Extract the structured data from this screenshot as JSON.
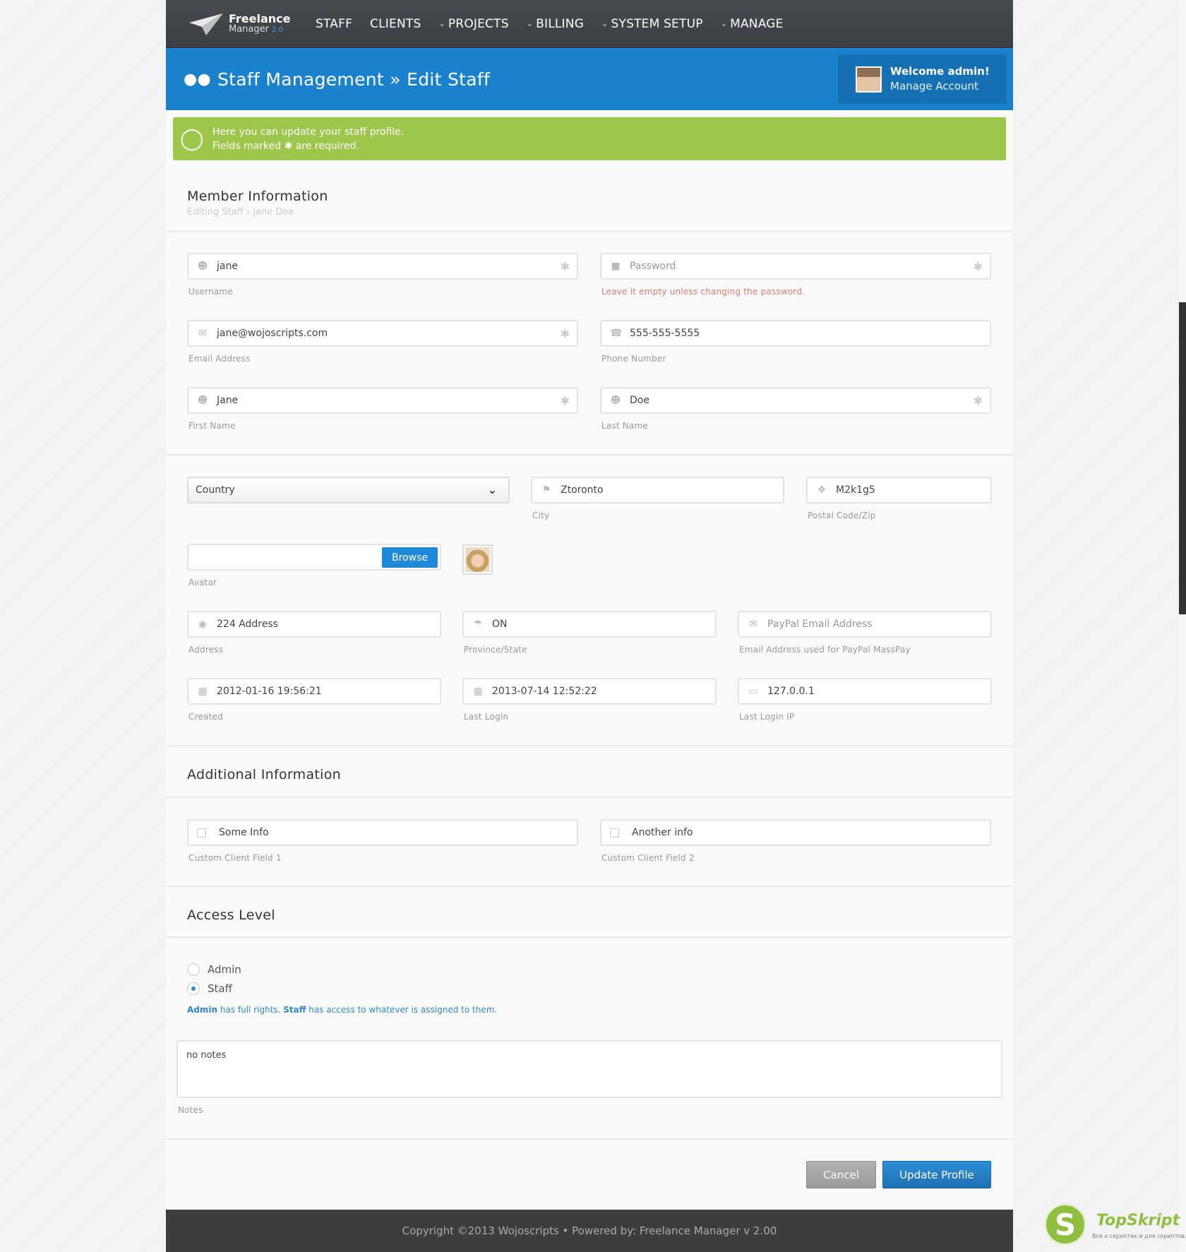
{
  "brand": {
    "name_line1": "Freelance",
    "name_line2": "Manager",
    "version": "2.0"
  },
  "nav": [
    {
      "label": "STAFF",
      "dropdown": false
    },
    {
      "label": "CLIENTS",
      "dropdown": false
    },
    {
      "label": "PROJECTS",
      "dropdown": true
    },
    {
      "label": "BILLING",
      "dropdown": true
    },
    {
      "label": "SYSTEM SETUP",
      "dropdown": true
    },
    {
      "label": "MANAGE",
      "dropdown": true
    }
  ],
  "header": {
    "title": "Staff Management » Edit Staff",
    "welcome": "Welcome admin!",
    "manage_account": "Manage Account"
  },
  "notice": {
    "line1": "Here you can update your staff profile.",
    "line2_pre": "Fields marked",
    "line2_post": "are required."
  },
  "member": {
    "title": "Member Information",
    "breadcrumb": "Editing Staff › Jane Doe",
    "username": {
      "value": "jane",
      "label": "Username"
    },
    "password": {
      "placeholder": "Password",
      "hint": "Leave it empty unless changing the password."
    },
    "email": {
      "value": "jane@wojoscripts.com",
      "label": "Email Address"
    },
    "phone": {
      "value": "555-555-5555",
      "label": "Phone Number"
    },
    "first_name": {
      "value": "Jane",
      "label": "First Name"
    },
    "last_name": {
      "value": "Doe",
      "label": "Last Name"
    },
    "country": {
      "value": "Country"
    },
    "city": {
      "value": "Ztoronto",
      "label": "City"
    },
    "postal": {
      "value": "M2k1g5",
      "label": "Postal Code/Zip"
    },
    "avatar": {
      "button": "Browse",
      "label": "Avatar"
    },
    "address": {
      "value": "224 Address",
      "label": "Address"
    },
    "province": {
      "value": "ON",
      "label": "Province/State"
    },
    "paypal": {
      "placeholder": "PayPal Email Address",
      "label": "Email Address used for PayPal MassPay"
    },
    "created": {
      "value": "2012-01-16 19:56:21",
      "label": "Created"
    },
    "last_login": {
      "value": "2013-07-14 12:52:22",
      "label": "Last Login"
    },
    "last_ip": {
      "value": "127.0.0.1",
      "label": "Last Login IP"
    }
  },
  "additional": {
    "title": "Additional Information",
    "field1": {
      "value": "Some Info",
      "label": "Custom Client Field 1"
    },
    "field2": {
      "value": "Another info",
      "label": "Custom Client Field 2"
    }
  },
  "access": {
    "title": "Access Level",
    "options": [
      "Admin",
      "Staff"
    ],
    "selected": "Staff",
    "note_admin": "Admin",
    "note_mid": " has full rights. ",
    "note_staff": "Staff",
    "note_end": " has access to whatever is assigned to them.",
    "notes_value": "no notes",
    "notes_label": "Notes"
  },
  "buttons": {
    "cancel": "Cancel",
    "update": "Update Profile"
  },
  "footer": {
    "text": "Copyright ©2013 Wojoscripts • Powered by: Freelance Manager v 2.00"
  },
  "watermark": {
    "name": "TopSkript",
    "letter": "S",
    "tagline": "Все о скриптах и для скриптов..."
  },
  "colors": {
    "blue": "#1a82cd",
    "green": "#9cc74a",
    "dark": "#3d3d3d"
  }
}
